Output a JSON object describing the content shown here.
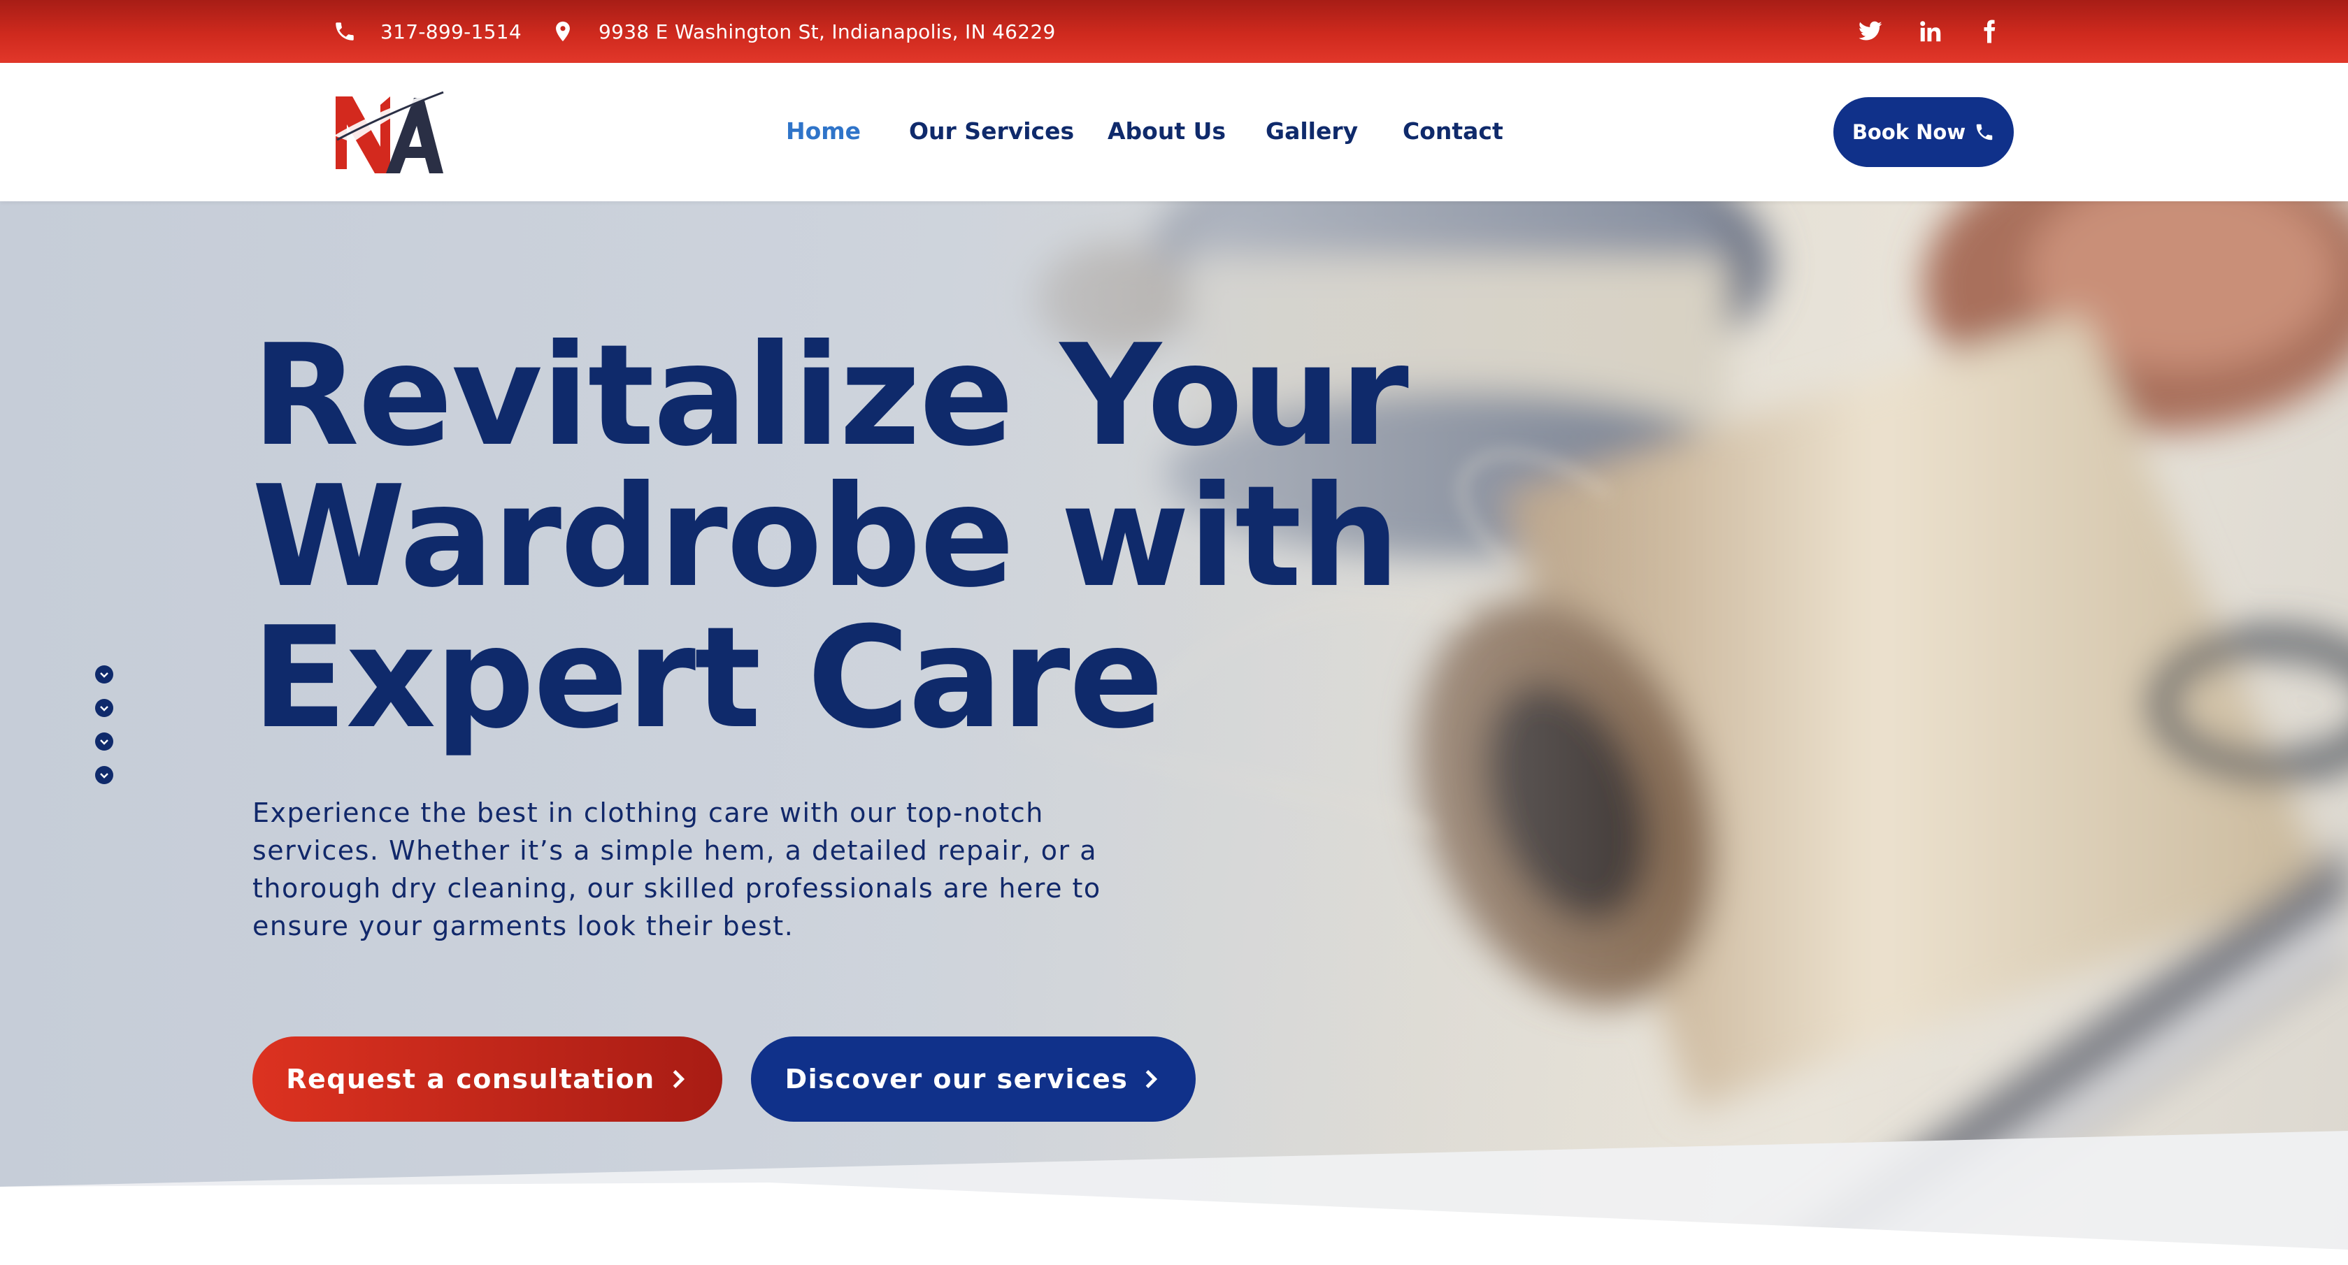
{
  "topbar": {
    "phone": "317-899-1514",
    "address": "9938 E Washington St, Indianapolis, IN 46229",
    "phone_icon": "phone-icon",
    "address_icon": "map-pin-icon",
    "social_icons": [
      "twitter-icon",
      "linkedin-icon",
      "facebook-icon"
    ]
  },
  "header": {
    "logo_alt": "NA",
    "nav": [
      {
        "label": "Home",
        "active": true
      },
      {
        "label": "Our Services",
        "active": false
      },
      {
        "label": "About Us",
        "active": false
      },
      {
        "label": "Gallery",
        "active": false
      },
      {
        "label": "Contact",
        "active": false
      }
    ],
    "book_label": "Book Now",
    "book_icon": "phone-icon"
  },
  "hero": {
    "headline_lines": [
      "Revitalize Your",
      "Wardrobe with",
      "Expert Care"
    ],
    "subtext": "Experience the best in clothing care with our top-notch services. Whether it’s a simple hem, a detailed repair, or a thorough dry cleaning, our skilled professionals are here to ensure your garments look their best.",
    "cta_primary": "Request a consultation",
    "cta_secondary": "Discover our services",
    "slide_dots": 4
  },
  "colors": {
    "brand_red": "#d3291e",
    "brand_navy": "#0f2a6b",
    "button_navy": "#10318a",
    "active_link": "#2f74c9"
  }
}
